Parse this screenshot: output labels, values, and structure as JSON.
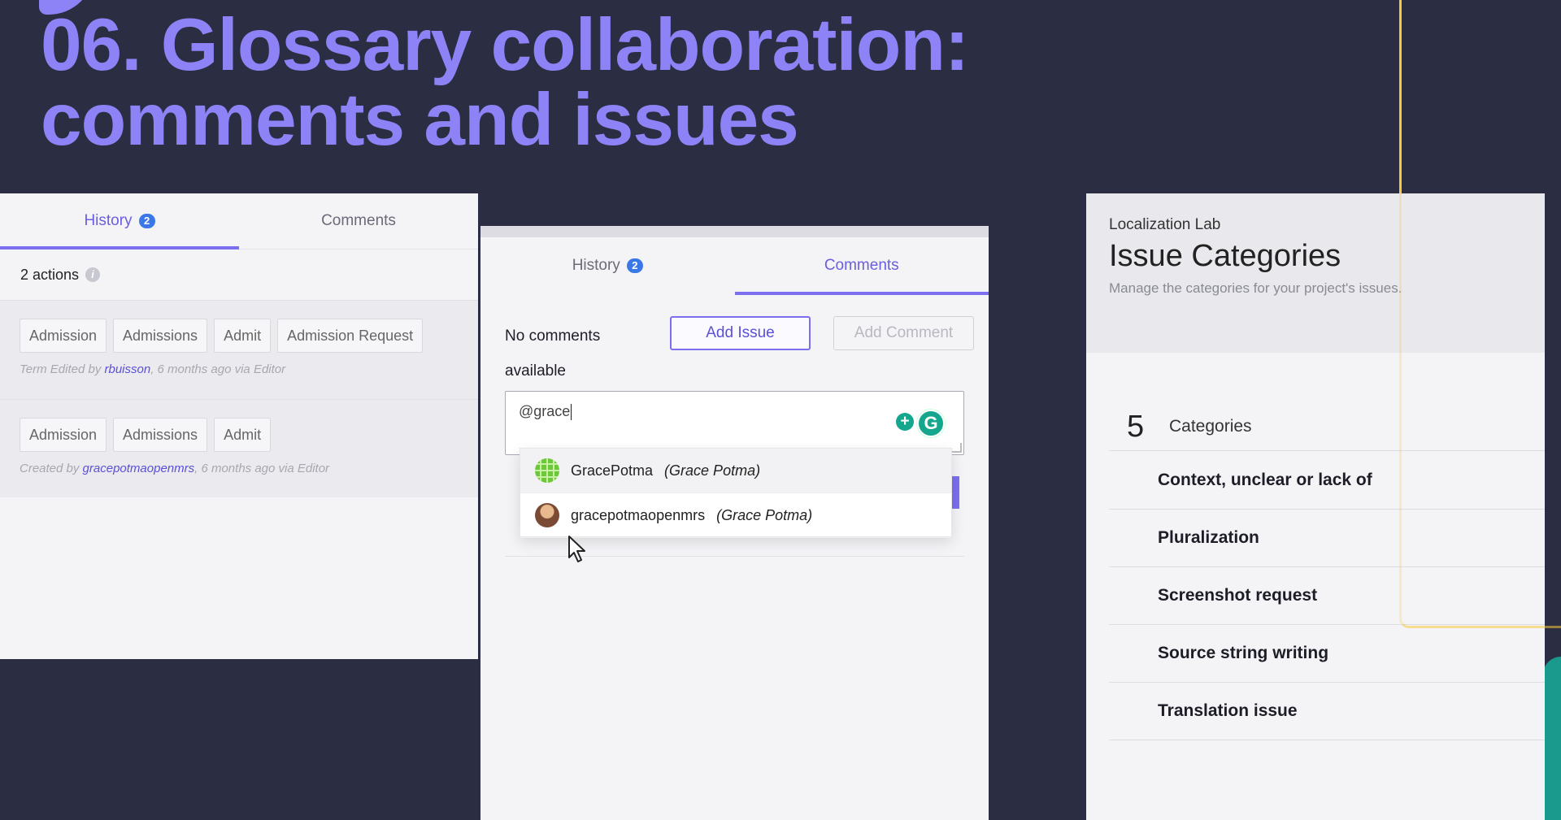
{
  "slide": {
    "title_line1": "06. Glossary collaboration:",
    "title_line2": "comments and issues"
  },
  "left_panel": {
    "tabs": [
      {
        "label": "History",
        "badge": "2",
        "active": true
      },
      {
        "label": "Comments",
        "active": false
      }
    ],
    "actions_count": "2 actions",
    "info_icon": "i",
    "entries": [
      {
        "terms": [
          "Admission",
          "Admissions",
          "Admit",
          "Admission Request"
        ],
        "meta_prefix": "Term Edited by ",
        "meta_user": "rbuisson",
        "meta_suffix": ", 6 months ago via Editor"
      },
      {
        "terms": [
          "Admission",
          "Admissions",
          "Admit"
        ],
        "meta_prefix": "Created by ",
        "meta_user": "gracepotmaopenmrs",
        "meta_suffix": ", 6 months ago via Editor"
      }
    ]
  },
  "center_panel": {
    "tabs": [
      {
        "label": "History",
        "badge": "2",
        "active": false
      },
      {
        "label": "Comments",
        "active": true
      }
    ],
    "no_comments_line1": "No comments",
    "no_comments_line2": "available",
    "add_issue_label": "Add Issue",
    "add_comment_label": "Add Comment",
    "comment_input_value": "@grace",
    "plus_icon_glyph": "+",
    "grammarly_icon_glyph": "G",
    "mention_suggestions": [
      {
        "handle": "GracePotma",
        "full_name": "(Grace Potma)",
        "avatar": "globe-avatar"
      },
      {
        "handle": "gracepotmaopenmrs",
        "full_name": "(Grace Potma)",
        "avatar": "photo-avatar"
      }
    ]
  },
  "right_panel": {
    "org": "Localization Lab",
    "title": "Issue Categories",
    "subtitle": "Manage the categories for your project's issues.",
    "count": "5",
    "count_label": "Categories",
    "categories": [
      "Context, unclear or lack of",
      "Pluralization",
      "Screenshot request",
      "Source string writing",
      "Translation issue"
    ]
  },
  "colors": {
    "background": "#2b2d42",
    "accent_purple": "#8e83f6",
    "tab_active": "#6a5ee0",
    "badge_blue": "#3b78e7",
    "grammarly_green": "#15a78e",
    "deco_yellow": "#f6c93b"
  }
}
